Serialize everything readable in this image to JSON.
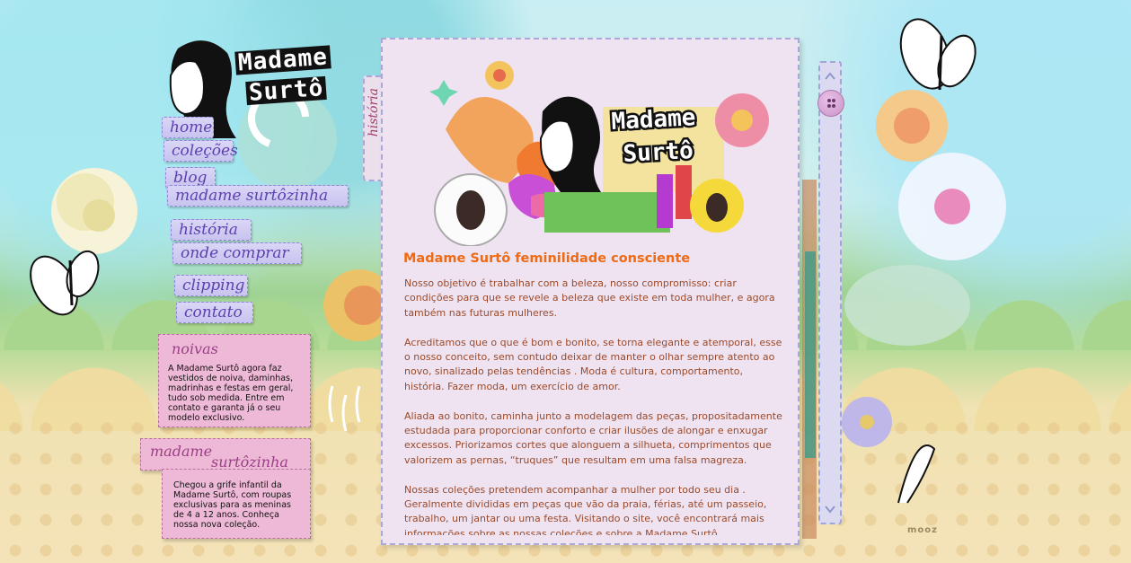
{
  "site": {
    "logo_line1": "Madame",
    "logo_line2": "Surtô"
  },
  "nav": {
    "items": [
      {
        "label": "home"
      },
      {
        "label": "coleções"
      },
      {
        "label": "blog"
      },
      {
        "label": "madame surtôzinha"
      },
      {
        "label": "história"
      },
      {
        "label": "onde comprar"
      },
      {
        "label": "clipping"
      },
      {
        "label": "contato"
      }
    ]
  },
  "noivas_card": {
    "title": "noivas",
    "text": "A Madame Surtô agora faz vestidos de noiva, daminhas, madrinhas e festas em geral, tudo sob medida. Entre em contato e garanta já o seu modelo exclusivo."
  },
  "kids_card": {
    "title_line1": "madame",
    "title_line2": "surtôzinha",
    "text": "Chegou a grife infantil da Madame Surtô, com roupas exclusivas para as meninas de 4 a 12 anos. Conheça nossa nova coleção."
  },
  "section_tab": "história",
  "banner": {
    "logo_line1": "Madame",
    "logo_line2": "Surtô"
  },
  "article": {
    "title": "Madame Surtô feminilidade consciente",
    "paragraphs": [
      "Nosso objetivo é trabalhar com a beleza, nosso compromisso: criar condições para que se revele a beleza que existe em toda mulher, e agora também nas futuras mulheres.",
      "Acreditamos que o que é bom e bonito, se torna elegante e atemporal, esse o nosso conceito, sem contudo deixar de manter o olhar sempre atento ao novo, sinalizado pelas tendências . Moda é cultura, comportamento, história. Fazer moda, um exercício de amor.",
      "Aliada ao bonito, caminha junto a modelagem das peças, propositadamente estudada para proporcionar conforto e criar ilusões de alongar e enxugar excessos. Priorizamos cortes que alonguem a silhueta, comprimentos que valorizem as pernas, “truques” que resultam em uma falsa magreza.",
      "Nossas coleções pretendem acompanhar a mulher por todo seu dia . Geralmente divididas em peças que vão da praia, férias, até um passeio, trabalho, um jantar ou uma festa. Visitando o site, você encontrará mais informações sobre as nossas coleções e sobre a Madame Surtô."
    ]
  },
  "footer": {
    "credit": "mooz"
  },
  "colors": {
    "accent_orange": "#ee6a14",
    "body_text": "#9a4a2a",
    "nav_text": "#5d3fae",
    "card_pink": "#eeb9d6",
    "panel_bg": "#efe3f1"
  }
}
